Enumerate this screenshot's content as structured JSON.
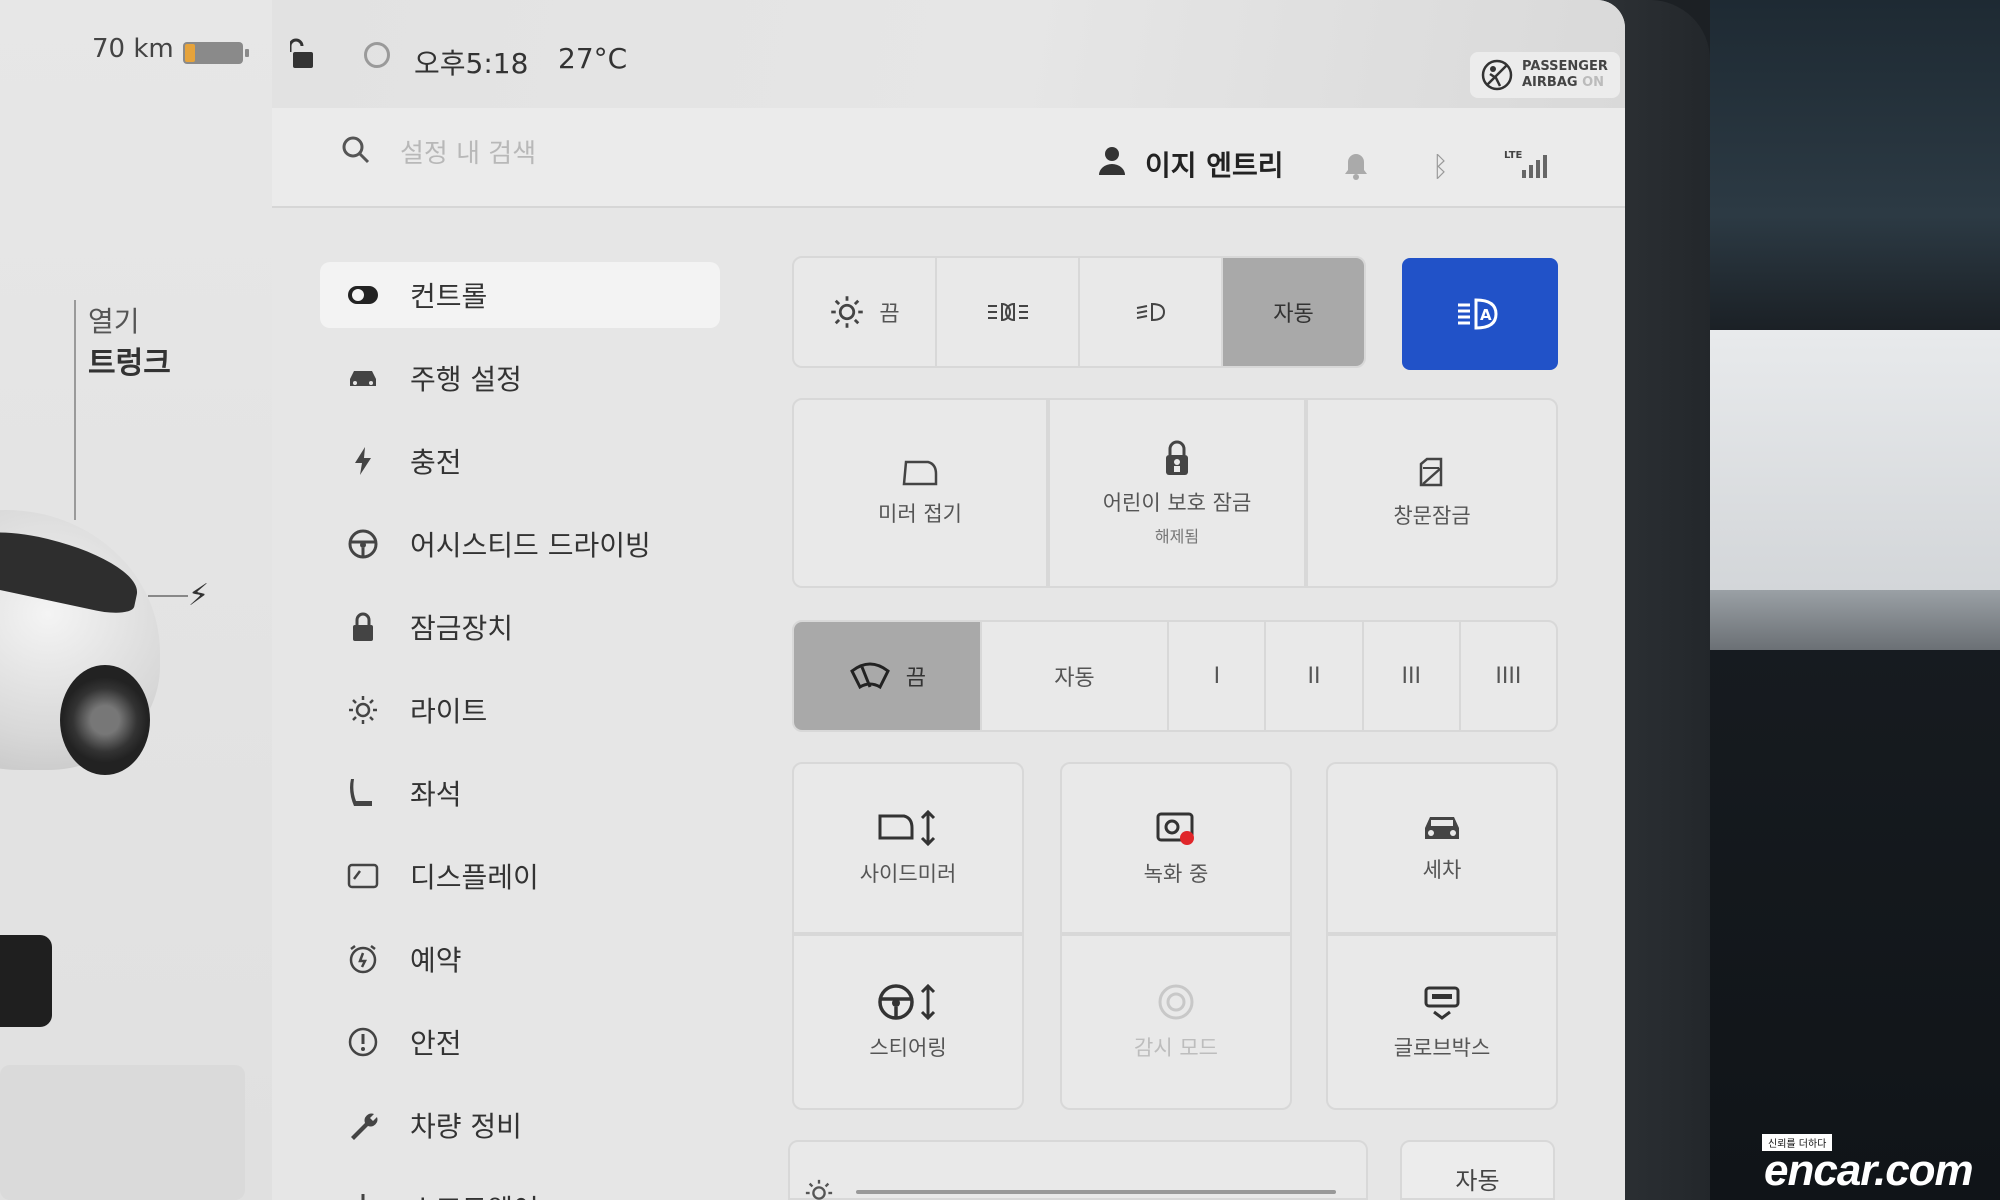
{
  "status": {
    "range": "70 km",
    "battery_level": 0.18,
    "time": "오후5:18",
    "temperature": "27°C",
    "airbag_line1": "PASSENGER",
    "airbag_line2": "AIRBAG",
    "airbag_state": "ON"
  },
  "car_panel": {
    "open_label": "열기",
    "trunk_label": "트렁크"
  },
  "search": {
    "placeholder": "설정 내 검색"
  },
  "profile": {
    "name": "이지 엔트리"
  },
  "network": {
    "lte": "LTE"
  },
  "sidebar": {
    "items": [
      {
        "label": "컨트롤",
        "icon": "toggle-icon"
      },
      {
        "label": "주행 설정",
        "icon": "car-icon"
      },
      {
        "label": "충전",
        "icon": "bolt-icon"
      },
      {
        "label": "어시스티드 드라이빙",
        "icon": "steering-wheel-icon"
      },
      {
        "label": "잠금장치",
        "icon": "lock-icon"
      },
      {
        "label": "라이트",
        "icon": "sun-icon"
      },
      {
        "label": "좌석",
        "icon": "seat-icon"
      },
      {
        "label": "디스플레이",
        "icon": "display-icon"
      },
      {
        "label": "예약",
        "icon": "alarm-icon"
      },
      {
        "label": "안전",
        "icon": "alert-icon"
      },
      {
        "label": "차량 정비",
        "icon": "wrench-icon"
      },
      {
        "label": "소프트웨어",
        "icon": "download-icon"
      }
    ]
  },
  "lights": {
    "off_label": "끔",
    "auto_label": "자동"
  },
  "quick": {
    "mirror_fold": "미러 접기",
    "child_lock": "어린이 보호 잠금",
    "child_lock_state": "해제됨",
    "window_lock": "창문잠금"
  },
  "wipers": {
    "off_label": "끔",
    "auto_label": "자동",
    "speeds": [
      "I",
      "II",
      "III",
      "IIII"
    ]
  },
  "controls": {
    "side_mirror": "사이드미러",
    "recording": "녹화 중",
    "car_wash": "세차",
    "steering": "스티어링",
    "sentry": "감시 모드",
    "glovebox": "글로브박스"
  },
  "display": {
    "auto_label": "자동"
  },
  "watermark": {
    "tag": "신뢰를 더하다",
    "text": "encar.com"
  },
  "colors": {
    "accent": "#2152c8",
    "battery": "#e6a33b",
    "recording_dot": "#e0262a"
  }
}
